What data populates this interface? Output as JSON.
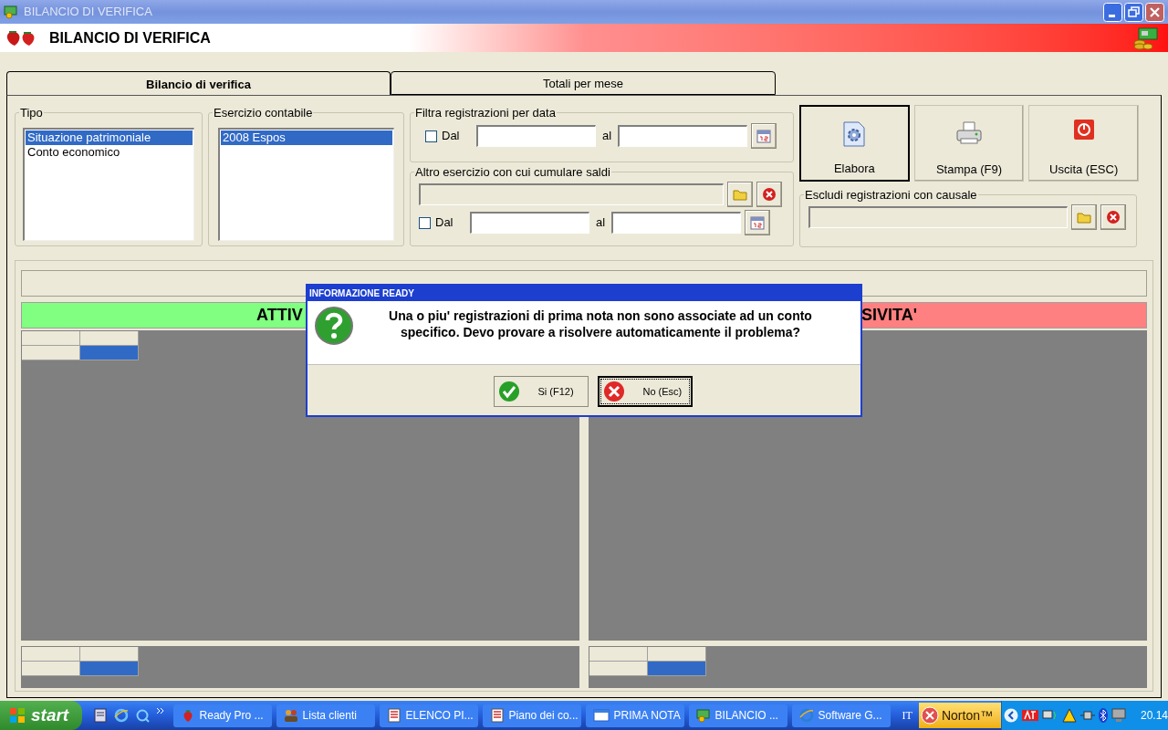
{
  "window": {
    "title": "BILANCIO DI VERIFICA"
  },
  "header": {
    "title": "BILANCIO DI VERIFICA"
  },
  "tabs": [
    {
      "label": "Bilancio di verifica",
      "selected": true
    },
    {
      "label": "Totali per mese",
      "selected": false
    }
  ],
  "tipo": {
    "label": "Tipo",
    "items": [
      {
        "label": "Situazione patrimoniale",
        "selected": true
      },
      {
        "label": "Conto economico",
        "selected": false
      }
    ]
  },
  "esercizio": {
    "label": "Esercizio contabile",
    "items": [
      {
        "label": "2008 Espos",
        "selected": true
      }
    ]
  },
  "filtro": {
    "label": "Filtra registrazioni per data",
    "from_label": "Dal",
    "from_checked": false,
    "to_label": "al"
  },
  "altro": {
    "label": "Altro esercizio con cui cumulare saldi",
    "from_label": "Dal",
    "from_checked": false,
    "to_label": "al"
  },
  "actions": [
    {
      "label": "Elabora",
      "kind": "process",
      "focused": true
    },
    {
      "label": "Stampa (F9)",
      "kind": "print",
      "focused": false
    },
    {
      "label": "Uscita (ESC)",
      "kind": "exit",
      "focused": false
    }
  ],
  "escludi": {
    "label": "Escludi registrazioni con causale"
  },
  "sections": [
    {
      "title": "ATTIV",
      "color": "#80ff80"
    },
    {
      "title": "SIVITA'",
      "color": "#ff8080"
    }
  ],
  "dialog": {
    "title": "INFORMAZIONE READY",
    "message": "Una o piu' registrazioni di prima nota non sono associate ad un conto specifico. Devo provare a risolvere automaticamente il problema?",
    "buttons": [
      {
        "label": "Si (F12)",
        "kind": "yes",
        "focused": false
      },
      {
        "label": "No (Esc)",
        "kind": "no",
        "focused": true
      }
    ]
  },
  "taskbar": {
    "start": "start",
    "tasks": [
      {
        "label": "Ready Pro ...",
        "kind": "strawberry"
      },
      {
        "label": "Lista clienti",
        "kind": "people"
      },
      {
        "label": "ELENCO PI...",
        "kind": "list"
      },
      {
        "label": "Piano dei co...",
        "kind": "list"
      },
      {
        "label": "PRIMA NOTA",
        "kind": "window"
      },
      {
        "label": "BILANCIO ...",
        "kind": "app"
      },
      {
        "label": "Software G...",
        "kind": "browser"
      }
    ],
    "language": "IT",
    "norton": "Norton™",
    "clock": "20.14"
  }
}
